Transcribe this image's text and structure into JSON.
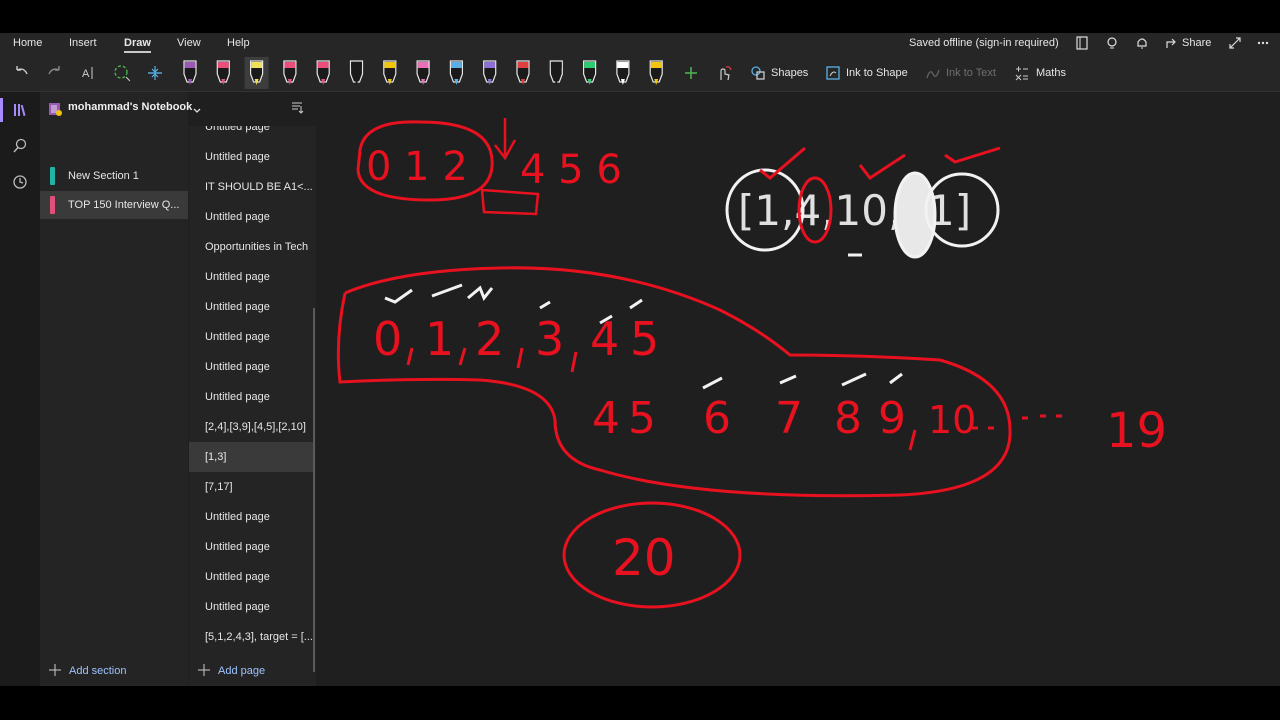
{
  "menu": {
    "items": [
      "Home",
      "Insert",
      "Draw",
      "View",
      "Help"
    ],
    "active": "Draw",
    "status": "Saved offline (sign-in required)",
    "share_label": "Share"
  },
  "toolbar": {
    "shapes_label": "Shapes",
    "ink_to_shape_label": "Ink to Shape",
    "ink_to_text_label": "Ink to Text",
    "maths_label": "Maths",
    "pen_colors": [
      "#9b59b6",
      "#e94f7a",
      "#f1e05a",
      "#e94f7a",
      "#e94f7a",
      "#1a1a1a",
      "#f1c40f",
      "#e96fb6",
      "#5ab0e6",
      "#8e6fd6",
      "#e04040",
      "#1a1a1a",
      "#2ecc71",
      "#ffffff",
      "#f1c40f"
    ]
  },
  "notebook": {
    "title": "mohammad's Notebook",
    "sections": [
      {
        "label": "New Section 1",
        "color": "#21b3a6"
      },
      {
        "label": "TOP 150 Interview Q...",
        "color": "#e0507a"
      }
    ],
    "add_section_label": "Add section",
    "add_page_label": "Add page"
  },
  "pages": [
    "Untitled page",
    "Untitled page",
    "IT SHOULD BE A1<...",
    "Untitled page",
    "Opportunities in Tech",
    "Untitled page",
    "Untitled page",
    "Untitled page",
    "Untitled page",
    "Untitled page",
    "[2,4],[3,9],[4,5],[2,10]",
    "[1,3]",
    "[7,17]",
    "Untitled page",
    "Untitled page",
    "Untitled page",
    "Untitled page",
    "[5,1,2,4,3], target = [..."
  ],
  "selected_page_index": 11,
  "ink": {
    "top_digits": "0 1 2",
    "top_rest": "4 5 6",
    "array_text": "[1,4,10,  ,1]",
    "row1": [
      "0",
      "1",
      "2",
      "3",
      "4",
      "5"
    ],
    "row2": [
      "4",
      "5",
      "6",
      "7",
      "8",
      "9",
      "10",
      "19"
    ],
    "circled": "20"
  },
  "colors": {
    "ink_red": "#e8111f",
    "ink_white": "#f2f2f2",
    "accent_purple": "#a78bfa"
  }
}
